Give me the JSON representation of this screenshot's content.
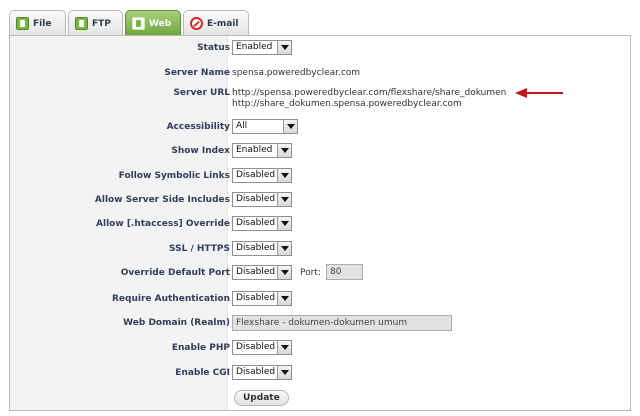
{
  "tabs": [
    {
      "label": "File",
      "icon": "file-icon"
    },
    {
      "label": "FTP",
      "icon": "ftp-icon"
    },
    {
      "label": "Web",
      "icon": "web-icon"
    },
    {
      "label": "E-mail",
      "icon": "email-icon"
    }
  ],
  "active_tab": "Web",
  "form": {
    "status": {
      "label": "Status",
      "value": "Enabled"
    },
    "server_name": {
      "label": "Server Name",
      "value": "spensa.poweredbyclear.com"
    },
    "server_url": {
      "label": "Server URL",
      "url1": "http://spensa.poweredbyclear.com/flexshare/share_dokumen",
      "url2": "http://share_dokumen.spensa.poweredbyclear.com"
    },
    "accessibility": {
      "label": "Accessibility",
      "value": "All"
    },
    "show_index": {
      "label": "Show Index",
      "value": "Enabled"
    },
    "follow_symlinks": {
      "label": "Follow Symbolic Links",
      "value": "Disabled"
    },
    "ssi": {
      "label": "Allow Server Side Includes",
      "value": "Disabled"
    },
    "htaccess": {
      "label": "Allow [.htaccess] Override",
      "value": "Disabled"
    },
    "ssl": {
      "label": "SSL / HTTPS",
      "value": "Disabled"
    },
    "override_port": {
      "label": "Override Default Port",
      "value": "Disabled",
      "port_label": "Port:",
      "port_value": "80"
    },
    "require_auth": {
      "label": "Require Authentication",
      "value": "Disabled"
    },
    "realm": {
      "label": "Web Domain (Realm)",
      "value": "Flexshare - dokumen-dokumen umum"
    },
    "php": {
      "label": "Enable PHP",
      "value": "Disabled"
    },
    "cgi": {
      "label": "Enable CGI",
      "value": "Disabled"
    }
  },
  "update_button": "Update",
  "colors": {
    "accent_green": "#78b742",
    "label_text": "#2f3e5e",
    "arrow": "#c0161b"
  }
}
